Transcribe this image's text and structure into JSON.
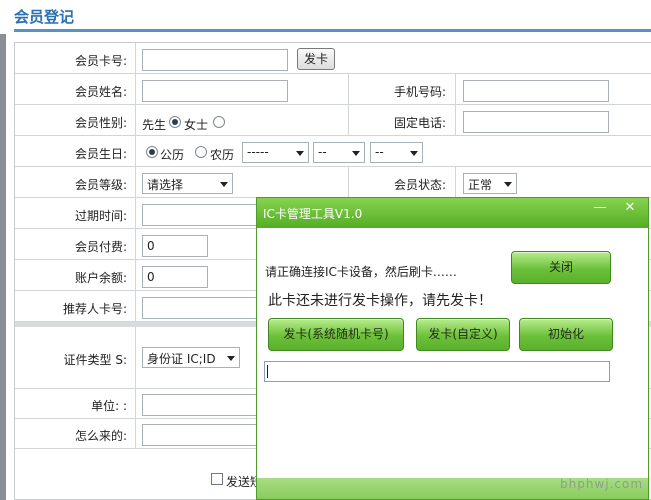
{
  "header": {
    "title": "会员登记"
  },
  "form": {
    "card_no": {
      "label": "会员卡号:",
      "value": "",
      "issue_button": "发卡"
    },
    "name": {
      "label": "会员姓名:",
      "value": ""
    },
    "mobile": {
      "label": "手机号码:",
      "value": ""
    },
    "gender": {
      "label": "会员性别:",
      "options": [
        "先生",
        "女士"
      ],
      "selected": "先生"
    },
    "phone": {
      "label": "固定电话:",
      "value": ""
    },
    "birthday": {
      "label": "会员生日:",
      "calendars": [
        "公历",
        "农历"
      ],
      "selected_calendar": "公历",
      "year": "-----",
      "month": "--",
      "day": "--"
    },
    "level": {
      "label": "会员等级:",
      "selected": "请选择"
    },
    "status": {
      "label": "会员状态:",
      "selected": "正常"
    },
    "expire": {
      "label": "过期时间:",
      "value": ""
    },
    "payment": {
      "label": "会员付费:",
      "value": "0"
    },
    "balance": {
      "label": "账户余额:",
      "value": "0"
    },
    "referrer": {
      "label": "推荐人卡号:",
      "value": ""
    },
    "id_type": {
      "label": "证件类型 S:",
      "selected": "身份证 IC;ID"
    },
    "unit": {
      "label": "单位: :",
      "value": ""
    },
    "source": {
      "label": "怎么来的:",
      "value": ""
    },
    "send_sms": {
      "label": "发送短",
      "checked": false
    }
  },
  "dialog": {
    "title": "IC卡管理工具V1.0",
    "minimize": "—",
    "close_x": "✕",
    "prompt": "请正确连接IC卡设备，然后刷卡……",
    "close_button": "关闭",
    "message": "此卡还未进行发卡操作，请先发卡！",
    "buttons": {
      "issue_random": "发卡(系统随机卡号)",
      "issue_custom": "发卡(自定义)",
      "init": "初始化"
    },
    "card_input": ""
  },
  "watermark": "bhphwj.com",
  "colors": {
    "accent": "#2a6fb1",
    "dialog_green": "#5bb02c"
  }
}
